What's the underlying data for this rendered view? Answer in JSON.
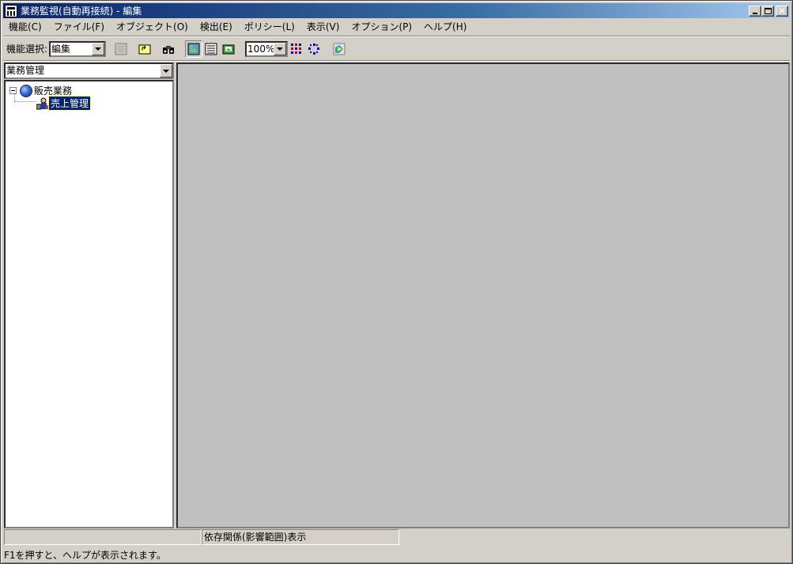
{
  "window": {
    "title": "業務監視(自動再接続) - 編集",
    "controls": [
      "minimize",
      "maximize",
      "close"
    ]
  },
  "menubar": {
    "items": [
      "機能(C)",
      "ファイル(F)",
      "オブジェクト(O)",
      "検出(E)",
      "ポリシー(L)",
      "表示(V)",
      "オプション(P)",
      "ヘルプ(H)"
    ]
  },
  "toolbar": {
    "function_label": "機能選択:",
    "function_value": "編集",
    "zoom_value": "100%",
    "icons": [
      "disabled-edit-icon",
      "folder-up-icon",
      "binoculars-icon",
      "map-view-icon",
      "list-view-icon",
      "image-view-icon",
      "grid-layout-icon",
      "circle-layout-icon",
      "refresh-monitor-icon"
    ]
  },
  "left_pane": {
    "selector_value": "業務管理",
    "tree": [
      {
        "label": "販売業務",
        "expanded": true,
        "icon": "globe-icon"
      },
      {
        "label": "売上管理",
        "selected": true,
        "icon": "business-icon"
      }
    ]
  },
  "statusbar": {
    "panel1": "",
    "panel2": "依存関係(影響範囲)表示",
    "hint": "F1を押すと、ヘルプが表示されます。"
  },
  "colors": {
    "titlebar_start": "#0a246a",
    "titlebar_end": "#a6caf0",
    "face": "#d4d0c8",
    "main_pane": "#c0c0c0",
    "selection": "#0a246a"
  }
}
